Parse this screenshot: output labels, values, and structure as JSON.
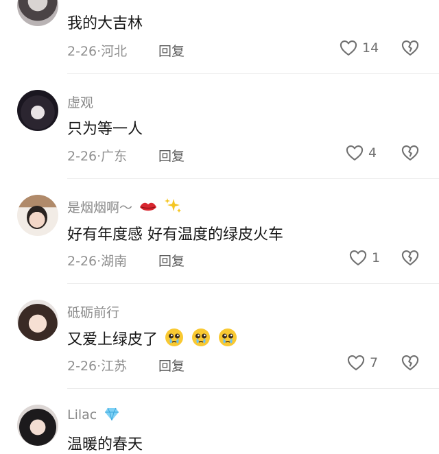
{
  "comments": [
    {
      "text": "我的大吉林",
      "date": "2-26",
      "location": "河北",
      "reply_label": "回复",
      "likes": "14"
    },
    {
      "username": "虚观",
      "text": "只为等一人",
      "date": "2-26",
      "location": "广东",
      "reply_label": "回复",
      "likes": "4"
    },
    {
      "username": "是烟烟啊～",
      "text": "好有年度感 好有温度的绿皮火车",
      "date": "2-26",
      "location": "湖南",
      "reply_label": "回复",
      "likes": "1"
    },
    {
      "username": "砥砺前行",
      "text": "又爱上绿皮了",
      "date": "2-26",
      "location": "江苏",
      "reply_label": "回复",
      "likes": "7"
    },
    {
      "username": "Lilac",
      "text": "温暖的春天"
    }
  ],
  "separator": "·",
  "icons": {
    "like": "heart-outline-icon",
    "dislike": "broken-heart-icon",
    "lips": "kiss-lips-emoji",
    "sparkles": "sparkles-emoji",
    "pleading": "pleading-face-emoji",
    "diamond": "diamond-emoji"
  },
  "colors": {
    "username": "#8a8a8a",
    "text": "#161616",
    "meta": "#8f8f8f",
    "divider": "#ececec"
  }
}
